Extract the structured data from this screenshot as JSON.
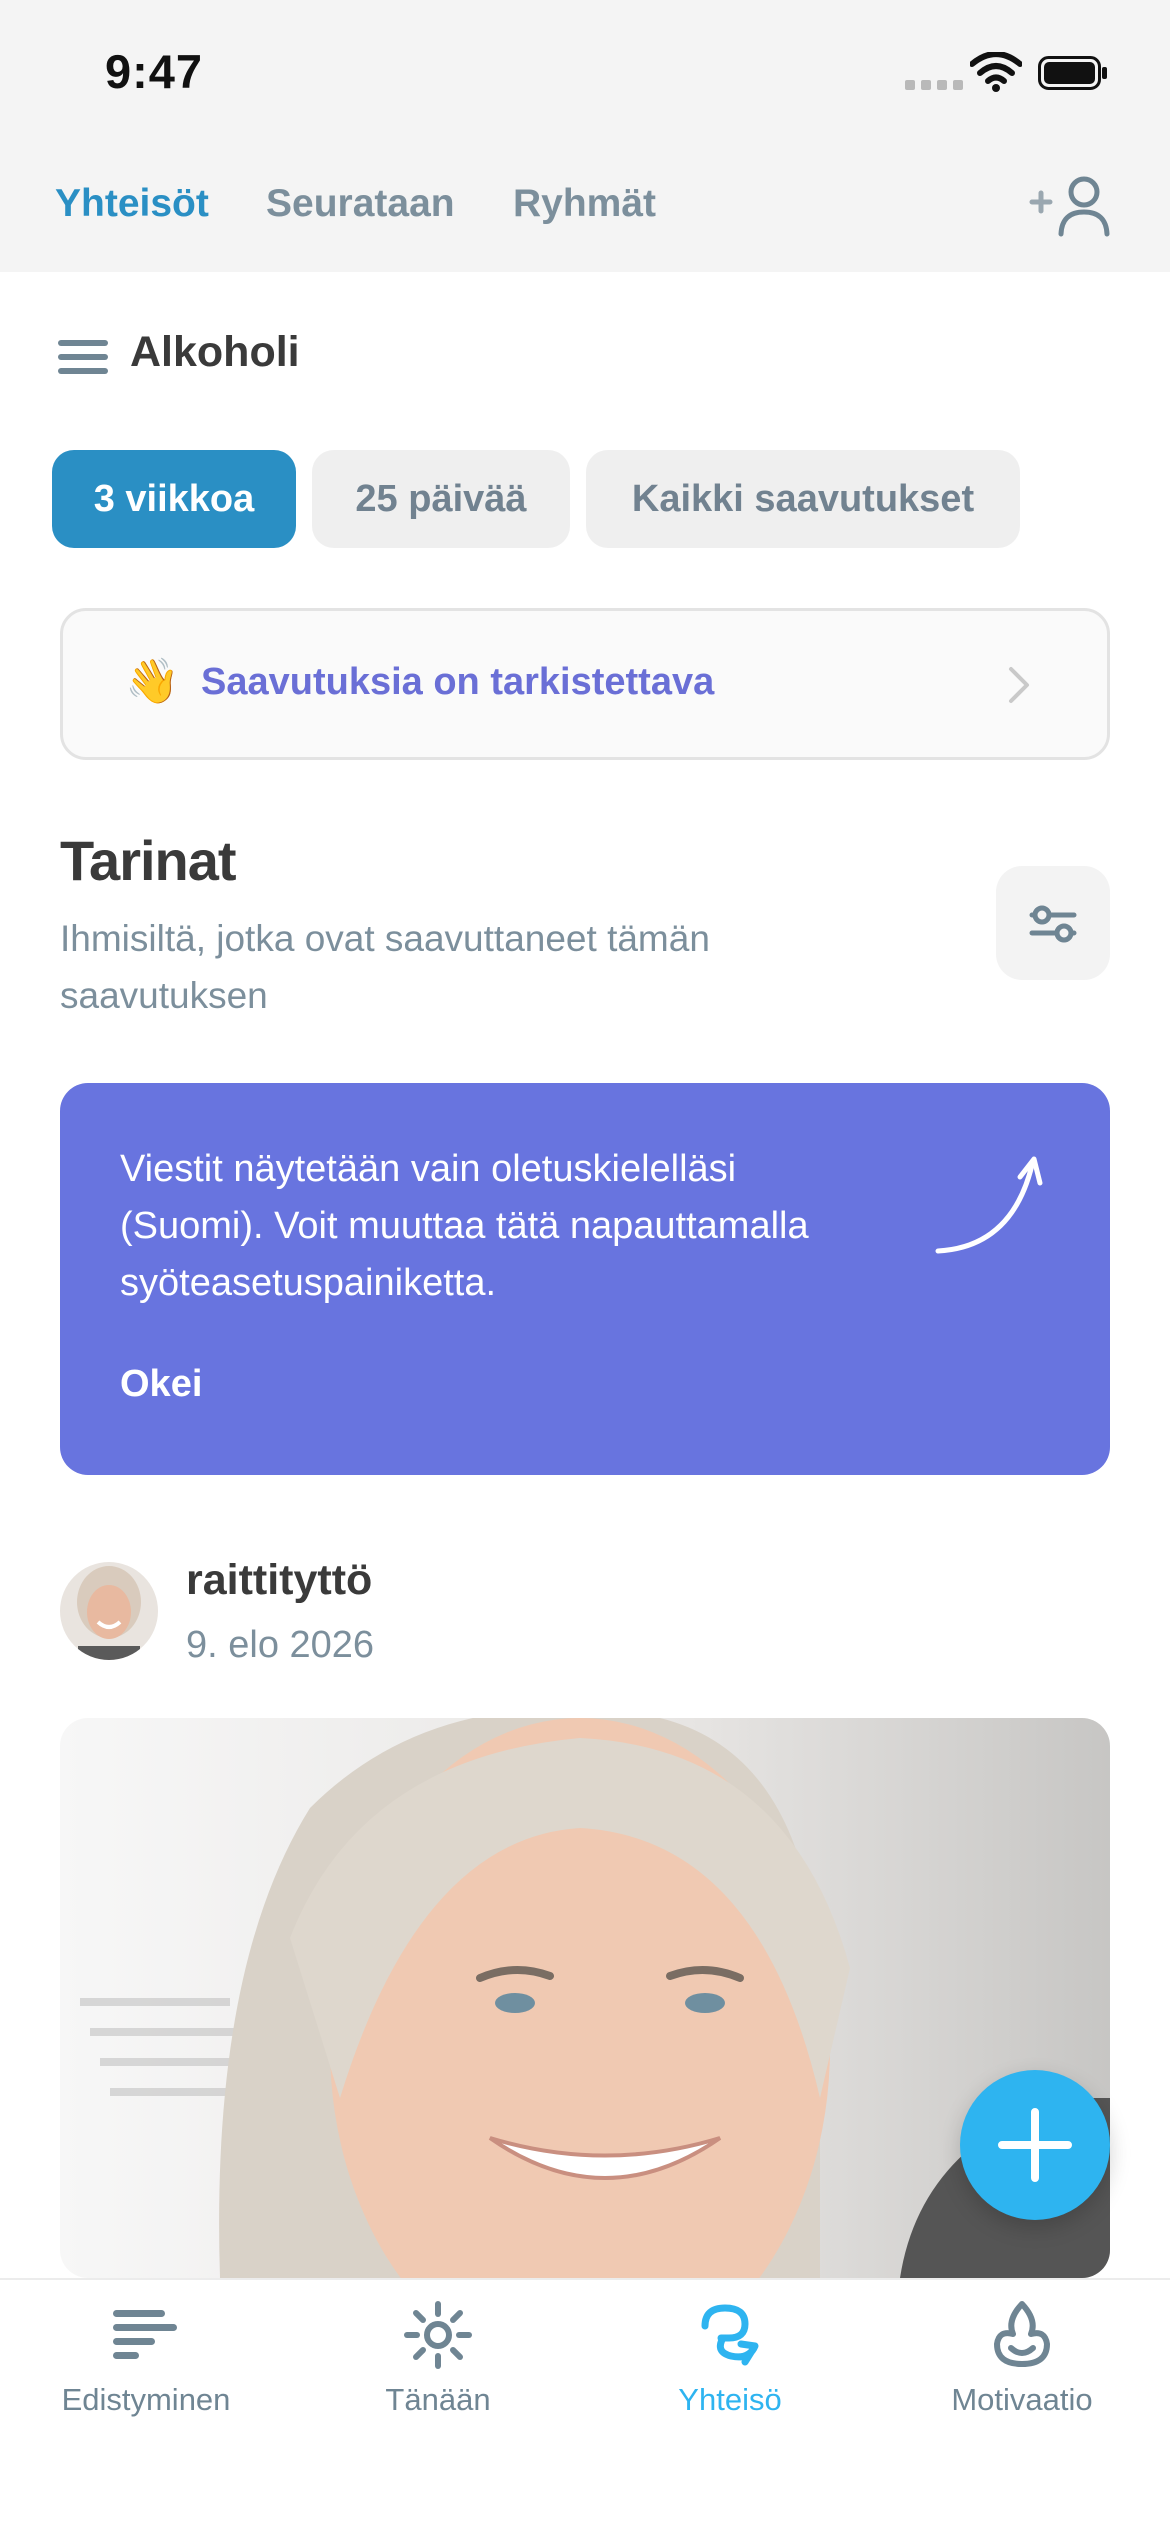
{
  "status_bar": {
    "time": "9:47"
  },
  "top_nav": {
    "tabs": [
      "Yhteisöt",
      "Seurataan",
      "Ryhmät"
    ],
    "active": "Yhteisöt"
  },
  "category": {
    "title": "Alkoholi",
    "filters": [
      "3 viikkoa",
      "25 päivää",
      "Kaikki saavutukset"
    ],
    "active_filter": "3 viikkoa"
  },
  "review_banner": {
    "emoji": "👋",
    "text": "Saavutuksia on tarkistettava"
  },
  "stories": {
    "title": "Tarinat",
    "subtitle": "Ihmisiltä, jotka ovat saavuttaneet tämän saavutuksen"
  },
  "language_notice": {
    "text": "Viestit näytetään vain oletuskielelläsi (Suomi). Voit muuttaa tätä napauttamalla syöteasetuspainiketta.",
    "button": "Okei"
  },
  "post": {
    "username": "raittityttö",
    "date": "9. elo 2026"
  },
  "tab_bar": {
    "items": [
      {
        "label": "Edistyminen",
        "icon": "progress-bars-icon"
      },
      {
        "label": "Tänään",
        "icon": "sun-icon"
      },
      {
        "label": "Yhteisö",
        "icon": "community-icon"
      },
      {
        "label": "Motivaatio",
        "icon": "motivation-icon"
      }
    ],
    "active": "Yhteisö"
  },
  "colors": {
    "accent": "#2a8fc4",
    "banner_purple": "#6874df",
    "fab_blue": "#2eb4f0",
    "muted_text": "#7c8f9c"
  }
}
